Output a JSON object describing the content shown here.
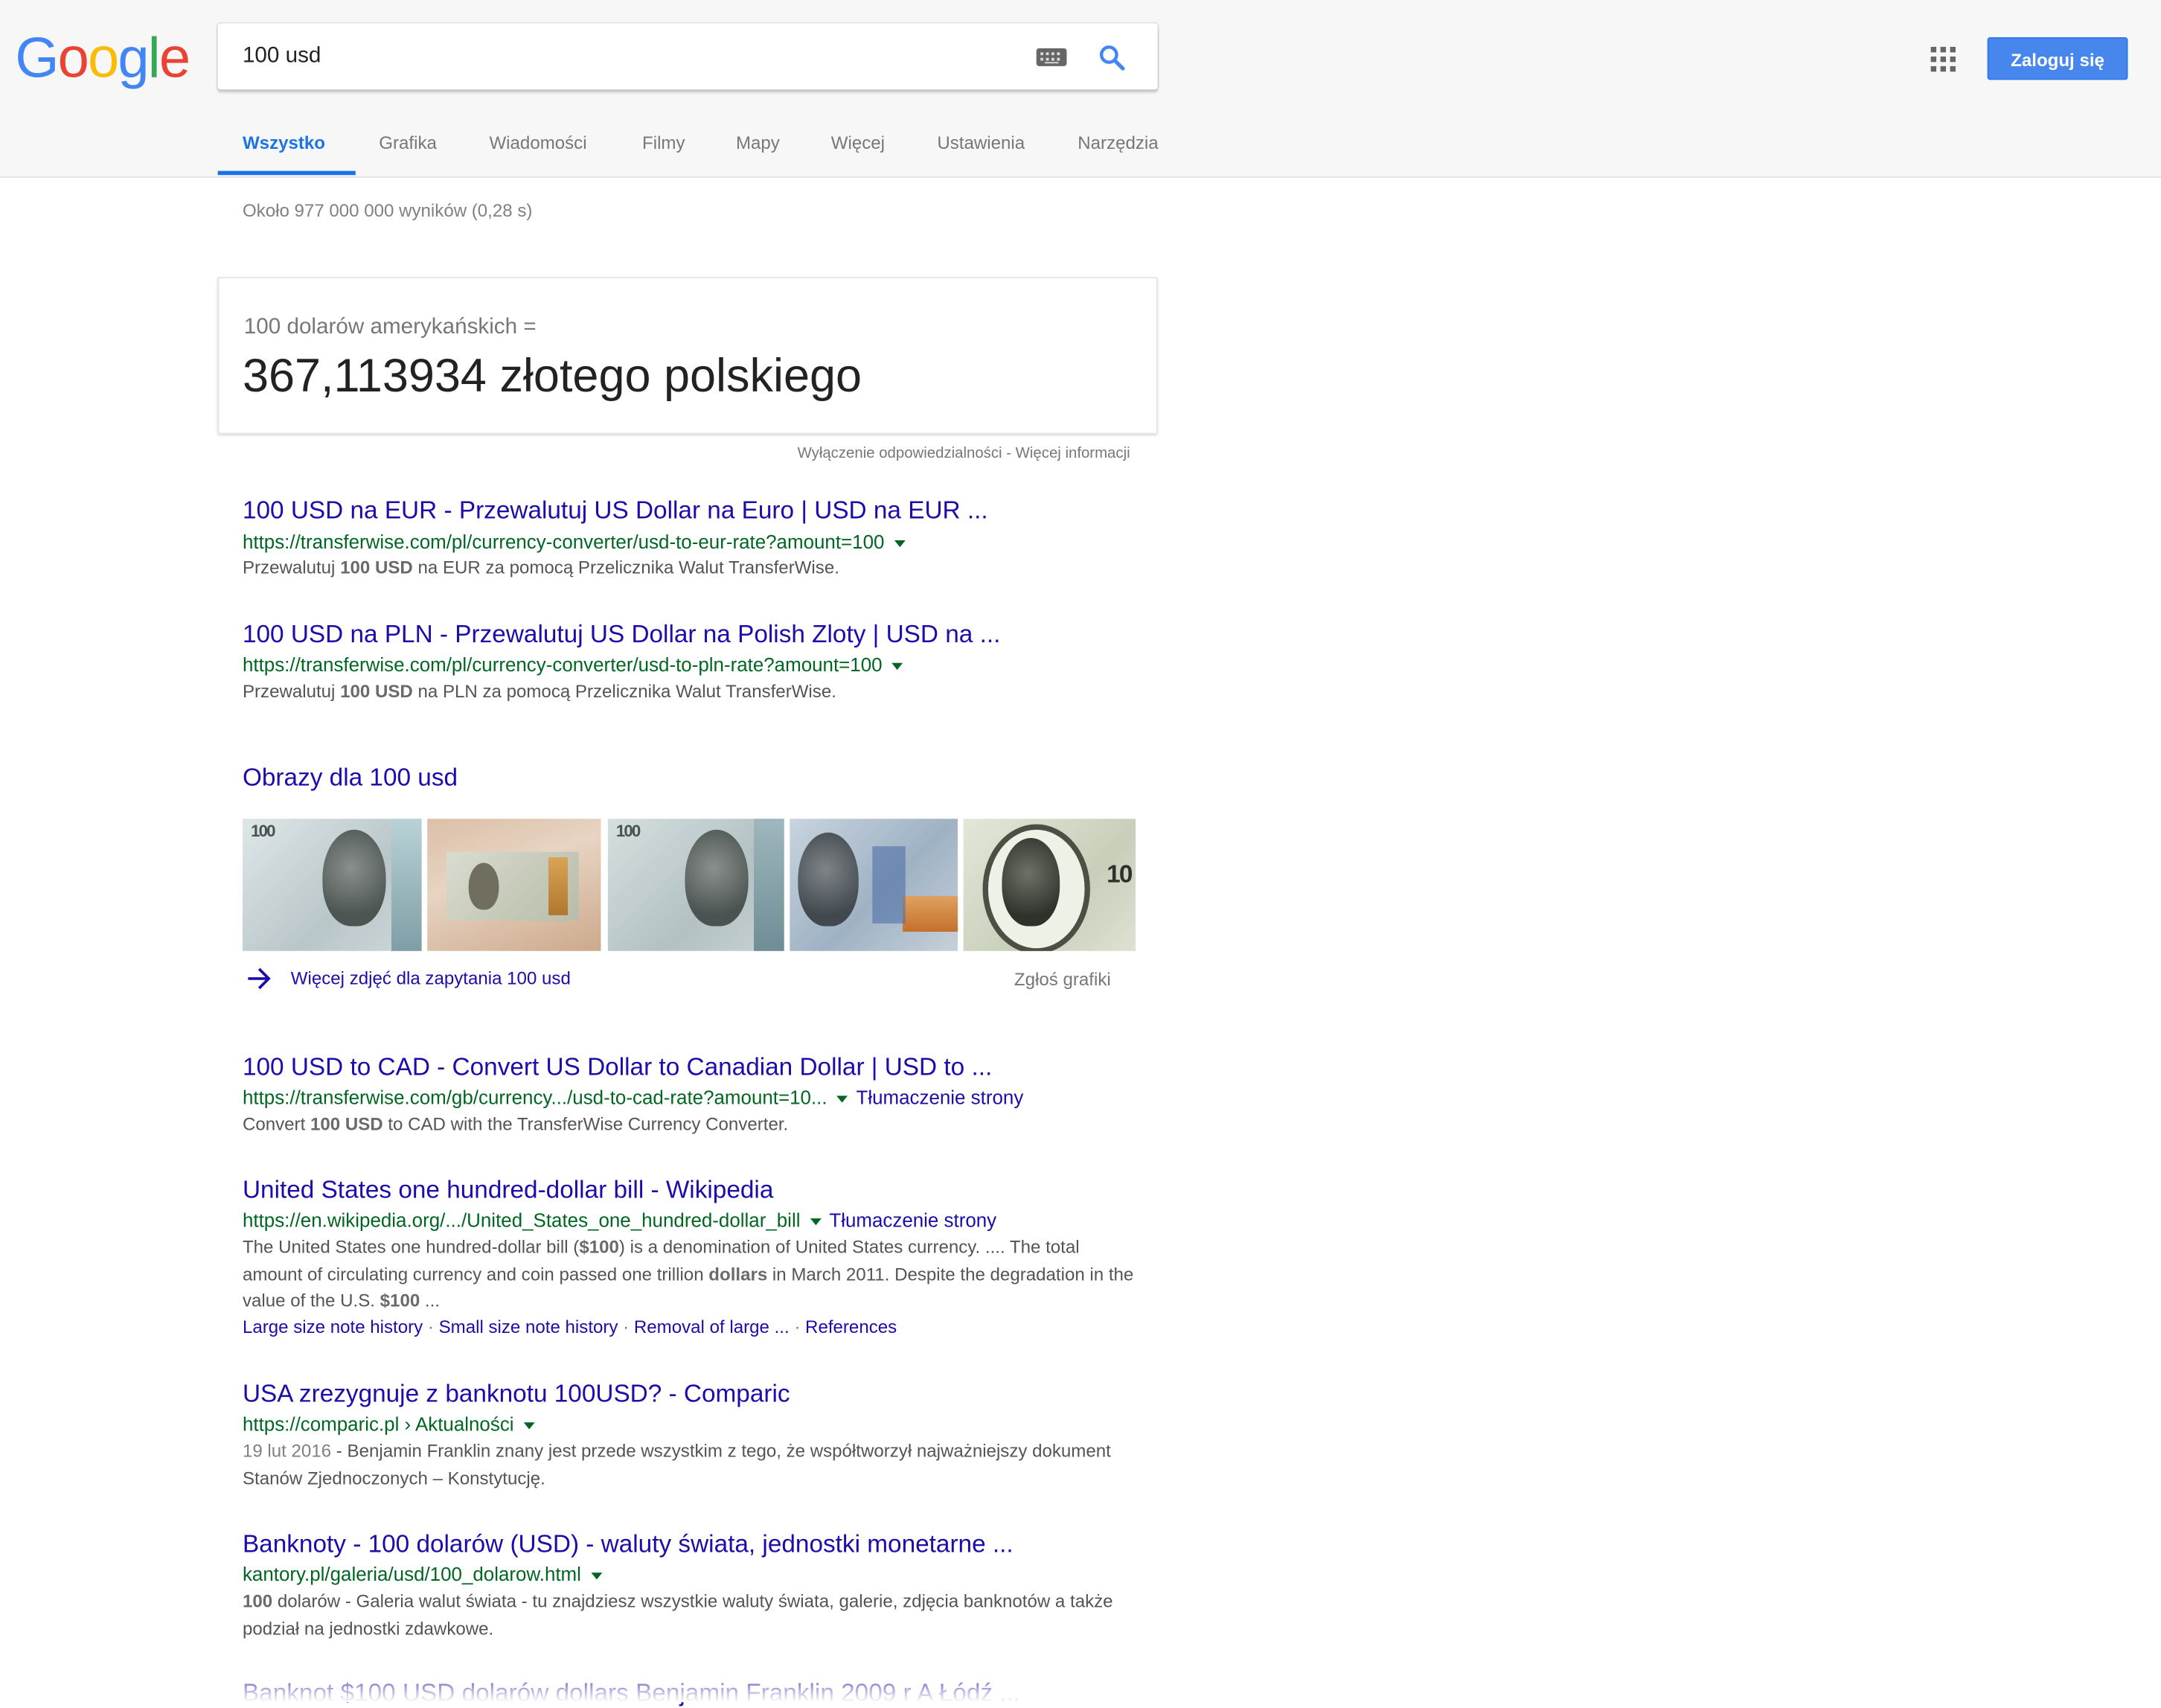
{
  "logo": {
    "letters": [
      "G",
      "o",
      "o",
      "g",
      "l",
      "e"
    ],
    "colors": [
      "#4285F4",
      "#EA4335",
      "#FBBC05",
      "#4285F4",
      "#34A853",
      "#EA4335"
    ]
  },
  "search": {
    "query": "100 usd",
    "icon": "search-icon",
    "keyboard_icon": "keyboard-icon"
  },
  "header": {
    "apps_icon": "apps-grid-icon",
    "signin_label": "Zaloguj się",
    "accent": "#4787ED"
  },
  "tabs": [
    {
      "label": "Wszystko",
      "active": true
    },
    {
      "label": "Grafika"
    },
    {
      "label": "Wiadomości"
    },
    {
      "label": "Filmy"
    },
    {
      "label": "Mapy"
    },
    {
      "label": "Więcej"
    },
    {
      "label": "Ustawienia"
    },
    {
      "label": "Narzędzia"
    }
  ],
  "result_stats": "Około 977 000 000 wyników (0,28 s)",
  "converter": {
    "from": "100 dolarów amerykańskich =",
    "result": "367,113934 złotego polskiego",
    "disclaimer": "Wyłączenie odpowiedzialności - Więcej informacji"
  },
  "results_top": [
    {
      "title": "100 USD na EUR - Przewalutuj US Dollar na Euro | USD na EUR ...",
      "url": "https://transferwise.com/pl/currency-converter/usd-to-eur-rate?amount=100",
      "snippet_pre": "Przewalutuj ",
      "snippet_bold": "100 USD",
      "snippet_post": " na EUR za pomocą Przelicznika Walut TransferWise."
    },
    {
      "title": "100 USD na PLN - Przewalutuj US Dollar na Polish Zloty | USD na ...",
      "url": "https://transferwise.com/pl/currency-converter/usd-to-pln-rate?amount=100",
      "snippet_pre": "Przewalutuj ",
      "snippet_bold": "100 USD",
      "snippet_post": " na PLN za pomocą Przelicznika Walut TransferWise."
    }
  ],
  "images": {
    "title": "Obrazy dla 100 usd",
    "more_label": "Więcej zdjęć dla zapytania 100 usd",
    "report_label": "Zgłoś grafiki"
  },
  "results_bottom": {
    "cad": {
      "title": "100 USD to CAD - Convert US Dollar to Canadian Dollar | USD to ...",
      "url": "https://transferwise.com/gb/currency.../usd-to-cad-rate?amount=10...",
      "translate": "Tłumaczenie strony",
      "snippet_pre": "Convert ",
      "snippet_bold": "100 USD",
      "snippet_post": " to CAD with the TransferWise Currency Converter."
    },
    "wiki": {
      "title": "United States one hundred-dollar bill - Wikipedia",
      "url": "https://en.wikipedia.org/.../United_States_one_hundred-dollar_bill",
      "translate": "Tłumaczenie strony",
      "s1": "The United States one hundred-dollar bill (",
      "s1b": "$100",
      "s2": ") is a denomination of United States currency. .... The total amount of circulating currency and coin passed one trillion ",
      "s2b": "dollars",
      "s3": " in March 2011. Despite the degradation in the value of the U.S. ",
      "s3b": "$100",
      "s4": " ...",
      "sitelinks": [
        "Large size note history",
        "Small size note history",
        "Removal of large ...",
        "References"
      ]
    },
    "comparic": {
      "title": "USA zrezygnuje z banknotu 100USD? - Comparic",
      "url": "https://comparic.pl › Aktualności",
      "date": "19 lut 2016",
      "snippet": " - Benjamin Franklin znany jest przede wszystkim z tego, że współtworzył najważniejszy dokument Stanów Zjednoczonych – Konstytucję."
    },
    "kantory": {
      "title": "Banknoty - 100 dolarów (USD) - waluty świata, jednostki monetarne ...",
      "url": "kantory.pl/galeria/usd/100_dolarow.html",
      "snippet_bold": "100",
      "snippet_post": " dolarów - Galeria walut świata - tu znajdziesz wszystkie waluty świata, galerie, zdjęcia banknotów a także podział na jednostki zdawkowe."
    },
    "last": {
      "title": "Banknot $100 USD dolarów dollars Benjamin Franklin 2009 r A Łódź ..."
    }
  }
}
